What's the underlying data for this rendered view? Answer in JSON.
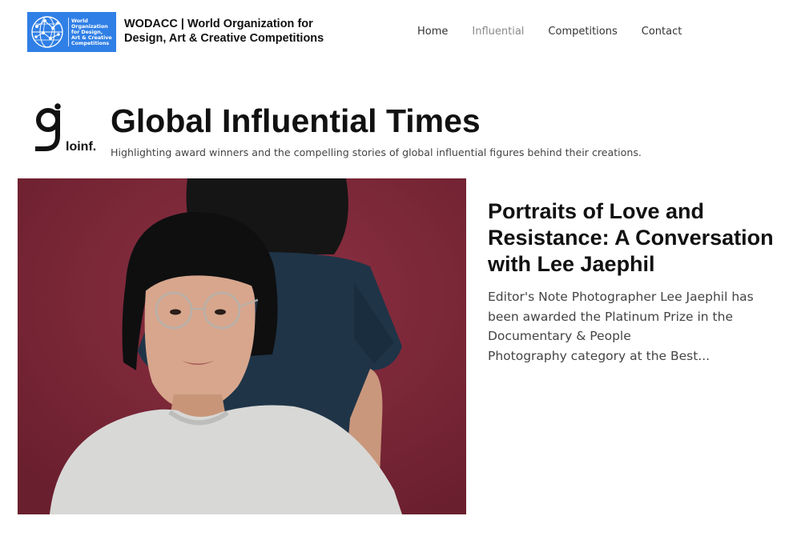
{
  "header": {
    "logo_lines": [
      "World",
      "Organization",
      "for Design,",
      "Art & Creative",
      "Competitions"
    ],
    "org_name_line1": "WODACC | World Organization for",
    "org_name_line2": "Design, Art & Creative Competitions",
    "brand_color": "#2f7fe6"
  },
  "nav": {
    "items": [
      {
        "label": "Home",
        "active": false
      },
      {
        "label": "Influential",
        "active": true
      },
      {
        "label": "Competitions",
        "active": false
      },
      {
        "label": "Contact",
        "active": false
      }
    ]
  },
  "section": {
    "mark_text": "loinf.",
    "title": "Global Influential Times",
    "subtitle": "Highlighting award winners and the compelling stories of global influential figures behind their creations."
  },
  "article": {
    "title": "Portraits of Love and Resistance: A Conversation with Lee Jaephil",
    "excerpt_lines": [
      "Editor's Note Photographer Lee Jaephil has",
      "been awarded the Platinum Prize in the",
      "Documentary & People",
      "Photography category at the Best..."
    ],
    "photo_background_color": "#7a2636"
  }
}
